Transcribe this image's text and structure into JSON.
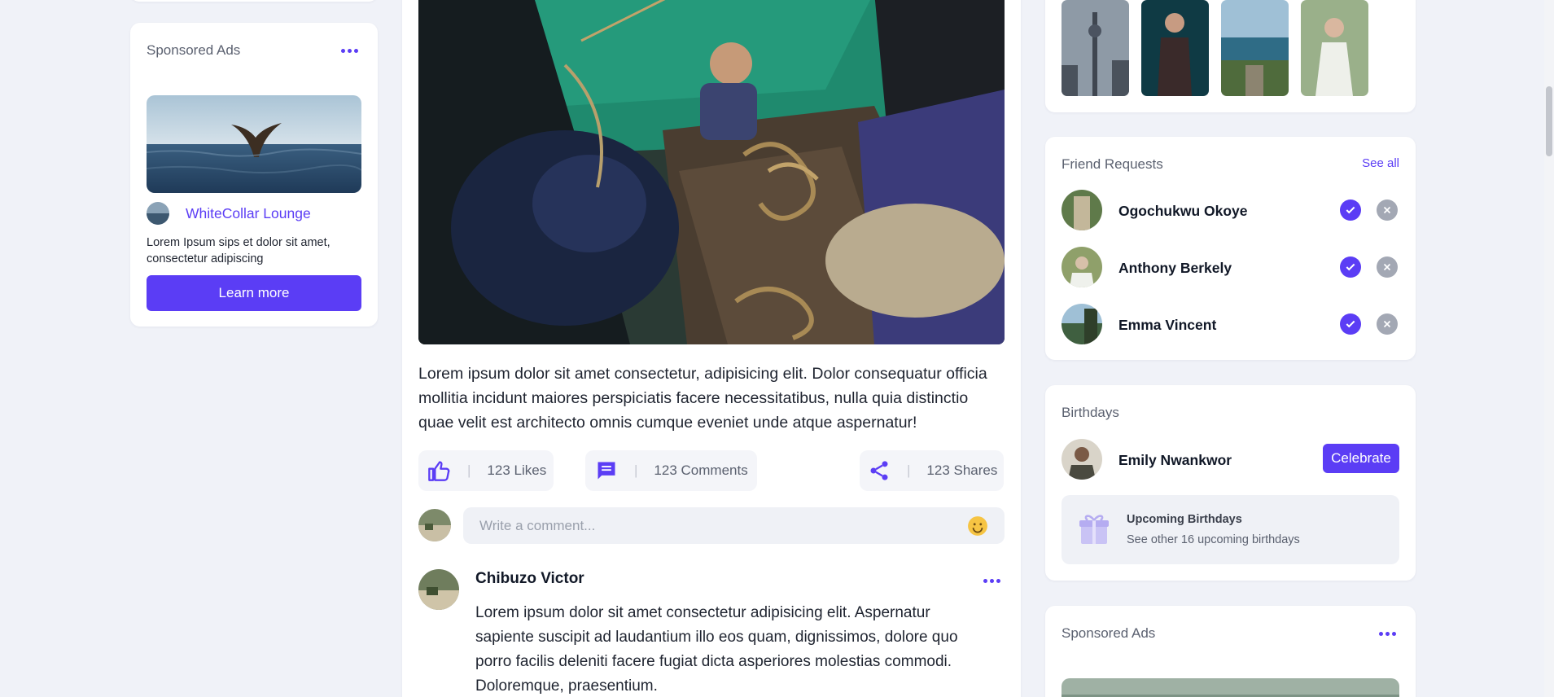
{
  "left_ad": {
    "title": "Sponsored Ads",
    "brand_name": "WhiteCollar Lounge",
    "description": "Lorem Ipsum sips et dolor sit amet, consectetur adipiscing",
    "cta": "Learn more"
  },
  "post": {
    "text": "Lorem ipsum dolor sit amet consectetur, adipisicing elit. Dolor consequatur officia mollitia incidunt maiores perspiciatis facere necessitatibus, nulla quia distinctio quae velit est architecto omnis cumque eveniet unde atque aspernatur!",
    "likes": "123 Likes",
    "comments": "123 Comments",
    "shares": "123 Shares",
    "separator": "|",
    "comment_placeholder": "Write a comment..."
  },
  "comment": {
    "author": "Chibuzo Victor",
    "text": "Lorem ipsum dolor sit amet consectetur adipisicing elit. Aspernatur sapiente suscipit ad laudantium illo eos quam, dignissimos, dolore quo porro facilis deleniti facere fugiat dicta asperiores molestias commodi. Doloremque, praesentium."
  },
  "friend_requests": {
    "title": "Friend Requests",
    "see_all": "See all",
    "people": [
      {
        "name": "Ogochukwu Okoye"
      },
      {
        "name": "Anthony Berkely"
      },
      {
        "name": "Emma Vincent"
      }
    ]
  },
  "birthdays": {
    "title": "Birthdays",
    "person": "Emily Nwankwor",
    "celebrate": "Celebrate",
    "upcoming_title": "Upcoming Birthdays",
    "upcoming_subtitle": "See other 16 upcoming birthdays"
  },
  "right_ad": {
    "title": "Sponsored Ads"
  },
  "colors": {
    "accent": "#5b3df5",
    "background": "#f0f2f8",
    "card": "#ffffff"
  },
  "icons": [
    "more-dots-icon",
    "thumbs-up-icon",
    "comment-icon",
    "share-icon",
    "smiley-icon",
    "check-icon",
    "close-icon",
    "gift-icon"
  ]
}
